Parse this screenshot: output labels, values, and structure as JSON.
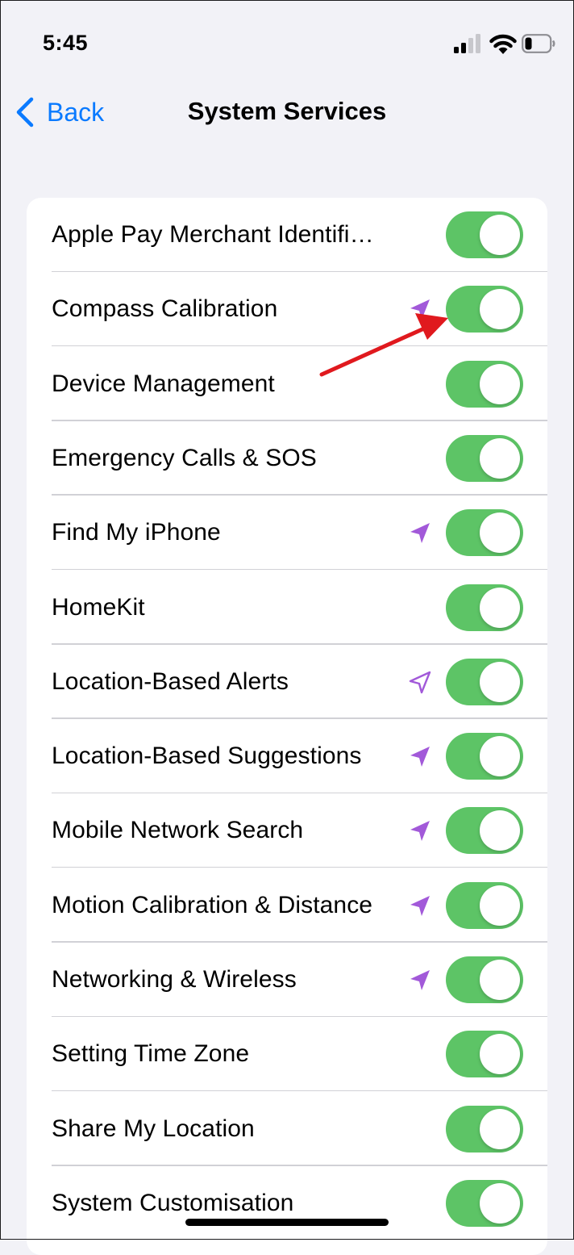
{
  "status_bar": {
    "time": "5:45",
    "icons": [
      "cellular-signal-icon",
      "wifi-icon",
      "battery-icon"
    ]
  },
  "nav": {
    "back_label": "Back",
    "title": "System Services"
  },
  "colors": {
    "toggle_on": "#5dc466",
    "location_arrow": "#a259d9",
    "link_blue": "#0a7aff",
    "annotation_arrow": "#e0191e"
  },
  "services": [
    {
      "label": "Apple Pay Merchant Identifi…",
      "enabled": true,
      "location_icon": "none"
    },
    {
      "label": "Compass Calibration",
      "enabled": true,
      "location_icon": "filled"
    },
    {
      "label": "Device Management",
      "enabled": true,
      "location_icon": "none"
    },
    {
      "label": "Emergency Calls & SOS",
      "enabled": true,
      "location_icon": "none"
    },
    {
      "label": "Find My iPhone",
      "enabled": true,
      "location_icon": "filled"
    },
    {
      "label": "HomeKit",
      "enabled": true,
      "location_icon": "none"
    },
    {
      "label": "Location-Based Alerts",
      "enabled": true,
      "location_icon": "outline"
    },
    {
      "label": "Location-Based Suggestions",
      "enabled": true,
      "location_icon": "filled"
    },
    {
      "label": "Mobile Network Search",
      "enabled": true,
      "location_icon": "filled"
    },
    {
      "label": "Motion Calibration & Distance",
      "enabled": true,
      "location_icon": "filled"
    },
    {
      "label": "Networking & Wireless",
      "enabled": true,
      "location_icon": "filled"
    },
    {
      "label": "Setting Time Zone",
      "enabled": true,
      "location_icon": "none"
    },
    {
      "label": "Share My Location",
      "enabled": true,
      "location_icon": "none"
    },
    {
      "label": "System Customisation",
      "enabled": true,
      "location_icon": "none"
    }
  ]
}
